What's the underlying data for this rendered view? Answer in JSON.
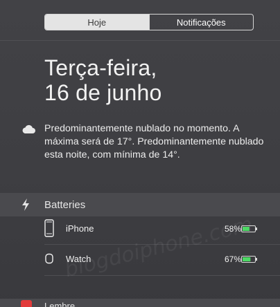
{
  "tabs": {
    "today": "Hoje",
    "notifications": "Notificações"
  },
  "date": {
    "line1": "Terça-feira,",
    "line2": "16 de junho"
  },
  "weather": {
    "icon": "cloud-icon",
    "text": "Predominantemente nublado no momento. A máxima será de 17°. Predominantemente nublado esta noite, com mínima de 14°."
  },
  "batteries": {
    "title": "Batteries",
    "icon": "bolt-icon",
    "devices": [
      {
        "name": "iPhone",
        "percent": "58%",
        "level": 0.58,
        "icon": "iphone-icon"
      },
      {
        "name": "Watch",
        "percent": "67%",
        "level": 0.67,
        "icon": "watch-icon"
      }
    ],
    "accent_color": "#4cd964"
  },
  "watermark": "blogdoiphone.com",
  "next_widget": {
    "label": "Lembre..."
  }
}
